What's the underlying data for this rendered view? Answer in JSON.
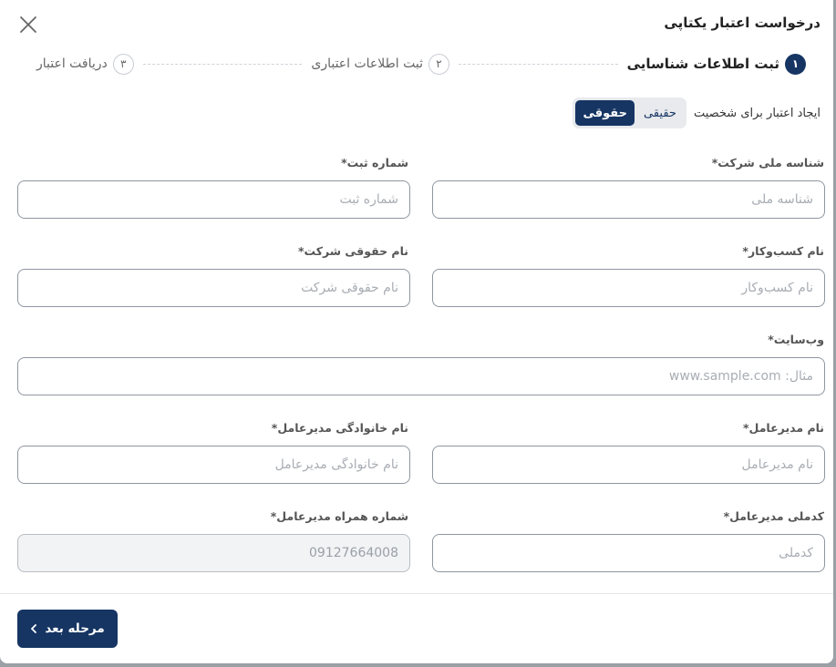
{
  "modal": {
    "title": "درخواست اعتبار یکتاپی"
  },
  "steps": [
    {
      "num": "۱",
      "label": "ثبت اطلاعات شناسایی",
      "active": true
    },
    {
      "num": "۲",
      "label": "ثبت اطلاعات اعتباری",
      "active": false
    },
    {
      "num": "۳",
      "label": "دریافت اعتبار",
      "active": false
    }
  ],
  "entity": {
    "label": "ایجاد اعتبار برای شخصیت",
    "options": [
      "حقیقی",
      "حقوقی"
    ],
    "selected": "حقوقی"
  },
  "fields": {
    "national_id": {
      "label": "شناسه ملی شرکت*",
      "placeholder": "شناسه ملی"
    },
    "registration": {
      "label": "شماره ثبت*",
      "placeholder": "شماره ثبت"
    },
    "business_name": {
      "label": "نام کسب‌وکار*",
      "placeholder": "نام کسب‌وکار"
    },
    "legal_name": {
      "label": "نام حقوقی شرکت*",
      "placeholder": "نام حقوقی شرکت"
    },
    "website": {
      "label": "وب‌سایت*",
      "placeholder": "مثال: www.sample.com"
    },
    "ceo_name": {
      "label": "نام مدیرعامل*",
      "placeholder": "نام مدیرعامل"
    },
    "ceo_family": {
      "label": "نام خانوادگی مدیرعامل*",
      "placeholder": "نام خانوادگی مدیرعامل"
    },
    "ceo_national_code": {
      "label": "کدملی مدیرعامل*",
      "placeholder": "کدملی"
    },
    "ceo_mobile": {
      "label": "شماره همراه مدیرعامل*",
      "value": "09127664008"
    }
  },
  "footer": {
    "next_label": "مرحله بعد"
  },
  "colors": {
    "primary": "#163563",
    "border": "#8f96a0"
  }
}
